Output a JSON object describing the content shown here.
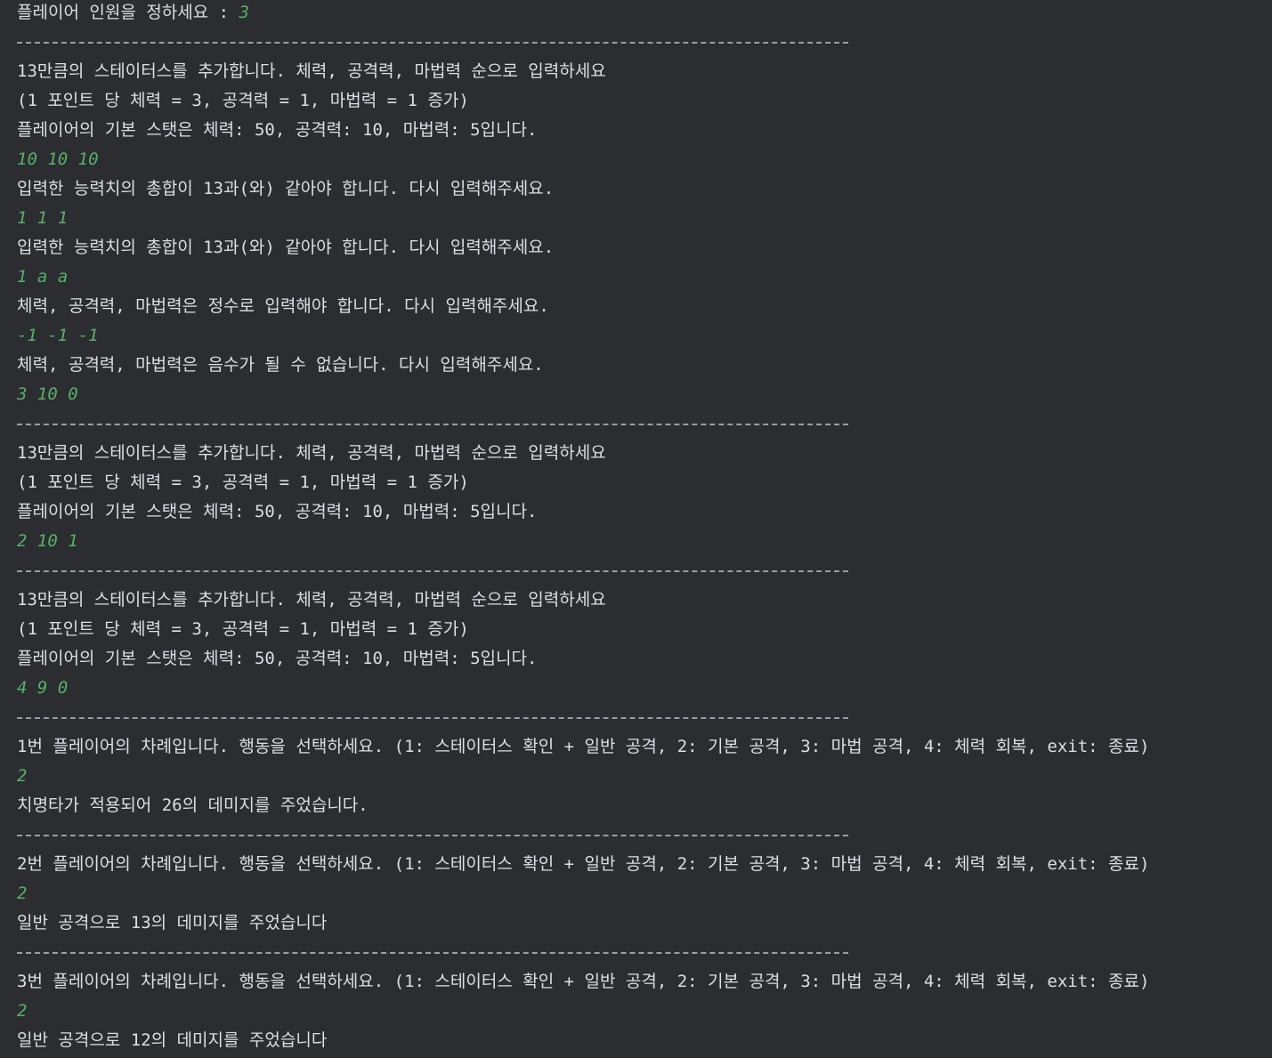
{
  "console": {
    "lines": [
      {
        "type": "output",
        "text": "플레이어 인원을 정하세요 : ",
        "input": "3"
      },
      {
        "type": "separator"
      },
      {
        "type": "output",
        "text": "13만큼의 스테이터스를 추가합니다. 체력, 공격력, 마법력 순으로 입력하세요"
      },
      {
        "type": "output",
        "text": "(1 포인트 당 체력 = 3, 공격력 = 1, 마법력 = 1 증가)"
      },
      {
        "type": "output",
        "text": "플레이어의 기본 스탯은 체력: 50, 공격력: 10, 마법력: 5입니다."
      },
      {
        "type": "input",
        "text": "10 10 10"
      },
      {
        "type": "output",
        "text": "입력한 능력치의 총합이 13과(와) 같아야 합니다. 다시 입력해주세요."
      },
      {
        "type": "input",
        "text": "1 1 1"
      },
      {
        "type": "output",
        "text": "입력한 능력치의 총합이 13과(와) 같아야 합니다. 다시 입력해주세요."
      },
      {
        "type": "input",
        "text": "1 a a"
      },
      {
        "type": "output",
        "text": "체력, 공격력, 마법력은 정수로 입력해야 합니다. 다시 입력해주세요."
      },
      {
        "type": "input",
        "text": "-1 -1 -1"
      },
      {
        "type": "output",
        "text": "체력, 공격력, 마법력은 음수가 될 수 없습니다. 다시 입력해주세요."
      },
      {
        "type": "input",
        "text": "3 10 0"
      },
      {
        "type": "separator"
      },
      {
        "type": "output",
        "text": "13만큼의 스테이터스를 추가합니다. 체력, 공격력, 마법력 순으로 입력하세요"
      },
      {
        "type": "output",
        "text": "(1 포인트 당 체력 = 3, 공격력 = 1, 마법력 = 1 증가)"
      },
      {
        "type": "output",
        "text": "플레이어의 기본 스탯은 체력: 50, 공격력: 10, 마법력: 5입니다."
      },
      {
        "type": "input",
        "text": "2 10 1"
      },
      {
        "type": "separator"
      },
      {
        "type": "output",
        "text": "13만큼의 스테이터스를 추가합니다. 체력, 공격력, 마법력 순으로 입력하세요"
      },
      {
        "type": "output",
        "text": "(1 포인트 당 체력 = 3, 공격력 = 1, 마법력 = 1 증가)"
      },
      {
        "type": "output",
        "text": "플레이어의 기본 스탯은 체력: 50, 공격력: 10, 마법력: 5입니다."
      },
      {
        "type": "input",
        "text": "4 9 0"
      },
      {
        "type": "separator"
      },
      {
        "type": "output",
        "text": "1번 플레이어의 차례입니다. 행동을 선택하세요. (1: 스테이터스 확인 + 일반 공격, 2: 기본 공격, 3: 마법 공격, 4: 체력 회복, exit: 종료)"
      },
      {
        "type": "input",
        "text": "2"
      },
      {
        "type": "output",
        "text": "치명타가 적용되어 26의 데미지를 주었습니다."
      },
      {
        "type": "separator"
      },
      {
        "type": "output",
        "text": "2번 플레이어의 차례입니다. 행동을 선택하세요. (1: 스테이터스 확인 + 일반 공격, 2: 기본 공격, 3: 마법 공격, 4: 체력 회복, exit: 종료)"
      },
      {
        "type": "input",
        "text": "2"
      },
      {
        "type": "output",
        "text": "일반 공격으로 13의 데미지를 주었습니다"
      },
      {
        "type": "separator"
      },
      {
        "type": "output",
        "text": "3번 플레이어의 차례입니다. 행동을 선택하세요. (1: 스테이터스 확인 + 일반 공격, 2: 기본 공격, 3: 마법 공격, 4: 체력 회복, exit: 종료)"
      },
      {
        "type": "input",
        "text": "2"
      },
      {
        "type": "output",
        "text": "일반 공격으로 12의 데미지를 주었습니다"
      }
    ]
  },
  "colors": {
    "background": "#2b2d30",
    "output_text": "#dcdfe4",
    "input_text": "#5aaf6a",
    "separator": "#9a9da3"
  }
}
